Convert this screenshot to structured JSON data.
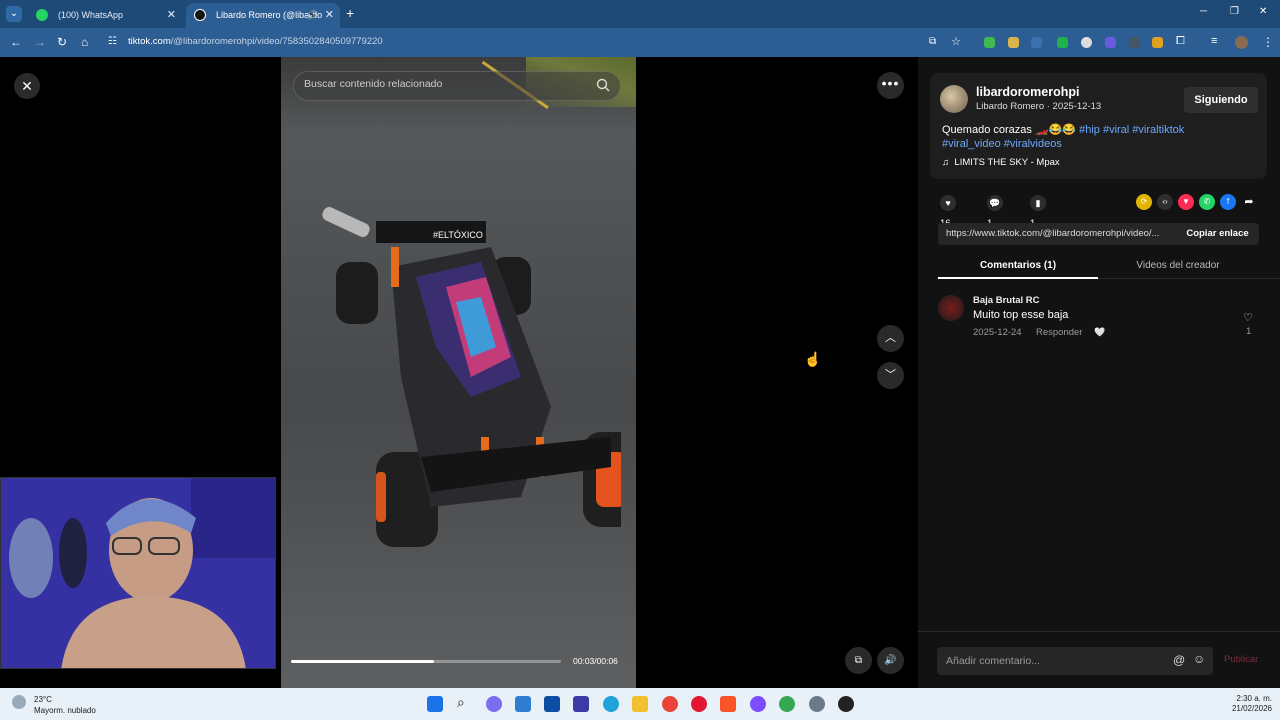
{
  "browser": {
    "tabs": [
      {
        "title": "(100) WhatsApp"
      },
      {
        "title": "Libardo Romero (@libardo"
      }
    ],
    "url_host": "tiktok.com",
    "url_path": "/@libardoromerohpi/video/7583502840509779220"
  },
  "video": {
    "search_placeholder": "Buscar contenido relacionado",
    "time": "00:03/00:06",
    "progress_fraction": 0.53,
    "car_text": "#ELTÓXICO"
  },
  "post": {
    "username": "libardoromerohpi",
    "display_meta": "Libardo Romero · 2025-12-13",
    "follow_label": "Siguiendo",
    "caption_text": "Quemado corazas",
    "caption_emoji": "🏎️😂😂",
    "hashtags_line1": "#hip #viral #viraltiktok",
    "hashtags_line2": "#viral_video #viralvideos",
    "music": "LIMITS THE SKY - Mpax",
    "likes": "16",
    "comments": "1",
    "saves": "1",
    "link": "https://www.tiktok.com/@libardoromerohpi/video/...",
    "copy_label": "Copiar enlace",
    "tab_comments": "Comentarios (1)",
    "tab_creator": "Videos del creador"
  },
  "comment": {
    "user": "Baja Brutal RC",
    "text": "Muito top esse baja",
    "date": "2025-12-24",
    "reply_label": "Responder",
    "likes": "1"
  },
  "comment_input": {
    "placeholder": "Añadir comentario...",
    "publish_label": "Publicar"
  },
  "taskbar": {
    "temp": "23°C",
    "weather": "Mayorm. nublado",
    "time": "2:30 a. m.",
    "date": "21/02/2026"
  },
  "colors": {
    "accent_link": "#6ea8ff",
    "chrome_blue": "#2c5d93",
    "panel_bg": "#121212"
  }
}
